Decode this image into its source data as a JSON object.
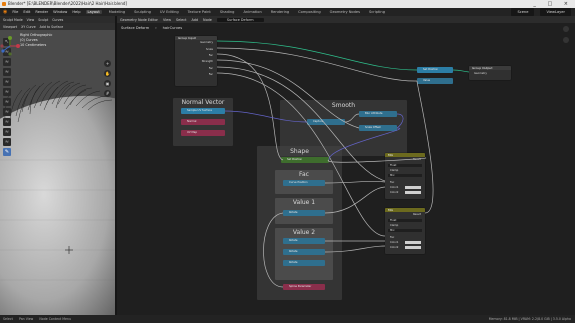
{
  "window": {
    "title": "Blender* [E:\\BLENDER\\Blender\\2022\\Hair\\2 Hair\\Hair.blend]",
    "controls": "_ □ ×"
  },
  "menubar": {
    "menus": [
      "File",
      "Edit",
      "Render",
      "Window",
      "Help"
    ],
    "workspaces": [
      "Layout",
      "Modeling",
      "Sculpting",
      "UV Editing",
      "Texture Paint",
      "Shading",
      "Animation",
      "Rendering",
      "Compositing",
      "Geometry Nodes",
      "Scripting"
    ],
    "active_workspace": "Layout",
    "scene_label": "Scene",
    "view_layer_label": "ViewLayer"
  },
  "viewport": {
    "header_items": [
      "Sculpt Mode",
      "View",
      "Sculpt",
      "Curves"
    ],
    "header2_items": [
      "Viewport",
      "XY Curve",
      "Add to Surface"
    ],
    "info_lines": [
      "Right Orthographic",
      "(0) Curves",
      "10 Centimeters"
    ],
    "tools": [
      "arrow-icon",
      "brush-icon",
      "brush-icon",
      "brush-icon",
      "brush-icon",
      "brush-icon",
      "brush-icon",
      "brush-icon",
      "brush-icon",
      "brush-icon",
      "brush-icon",
      "brush-icon"
    ]
  },
  "node_editor": {
    "header_items": [
      "Geometry Node Editor",
      "View",
      "Select",
      "Add",
      "Node"
    ],
    "tree_name": "Surface Deform",
    "breadcrumb": [
      "Surface Deform",
      "hairCurves"
    ],
    "group_input": {
      "title": "Group Input",
      "outputs": [
        "Geometry",
        "Scale",
        "Fac",
        "Strength",
        "Fac",
        "Fac"
      ]
    },
    "group_output": {
      "title": "Group Output",
      "inputs": [
        "Geometry"
      ]
    },
    "output_pills": [
      "Set Position",
      "Value"
    ],
    "frames": {
      "normal_vector": {
        "label": "Normal Vector",
        "pills": [
          "Sample UV Surface",
          "Normal",
          "UV Map"
        ]
      },
      "smooth": {
        "label": "Smooth",
        "pills": [
          "Capture",
          "Blur Attribute",
          "Scale Offset"
        ]
      },
      "shape": {
        "label": "Shape",
        "top_pill": "Set Position",
        "fac": {
          "label": "Fac",
          "pills": [
            "Curve Position"
          ]
        },
        "value1": {
          "label": "Value 1",
          "pills": [
            "Rotate"
          ]
        },
        "value2": {
          "label": "Value 2",
          "pills": [
            "Rotate",
            "Rotate",
            "Rotate"
          ]
        },
        "bottom_pill": "Spline Parameter"
      }
    },
    "mix_nodes": [
      {
        "title": "Mix",
        "out": "Result",
        "type": "Float",
        "clamp": "Clamp",
        "mode": "Mix",
        "rows": [
          "Fac",
          "Color1",
          "Color2"
        ]
      },
      {
        "title": "Mix",
        "out": "Result",
        "type": "Float",
        "clamp": "Clamp",
        "mode": "Mix",
        "rows": [
          "Fac",
          "Color1",
          "Color2"
        ]
      }
    ]
  },
  "statusbar": {
    "left_items": [
      "Select",
      "Pan View",
      "Node Context Menu"
    ],
    "right_text": "Memory: 81.8 MiB | VRAM: 2.2/8.0 GiB | 3.5.0 Alpha"
  },
  "colors": {
    "accent": "#4772b3",
    "blender_orange": "#e87d0d",
    "link_green": "#2fc28e",
    "link_blue": "#6b8ee0",
    "socket_gray": "#a1a1a1",
    "socket_purple": "#6363c7",
    "vector_socket": "#6363c7",
    "geometry_socket": "#00d6a3",
    "mix_header": "#6c6a1e"
  }
}
